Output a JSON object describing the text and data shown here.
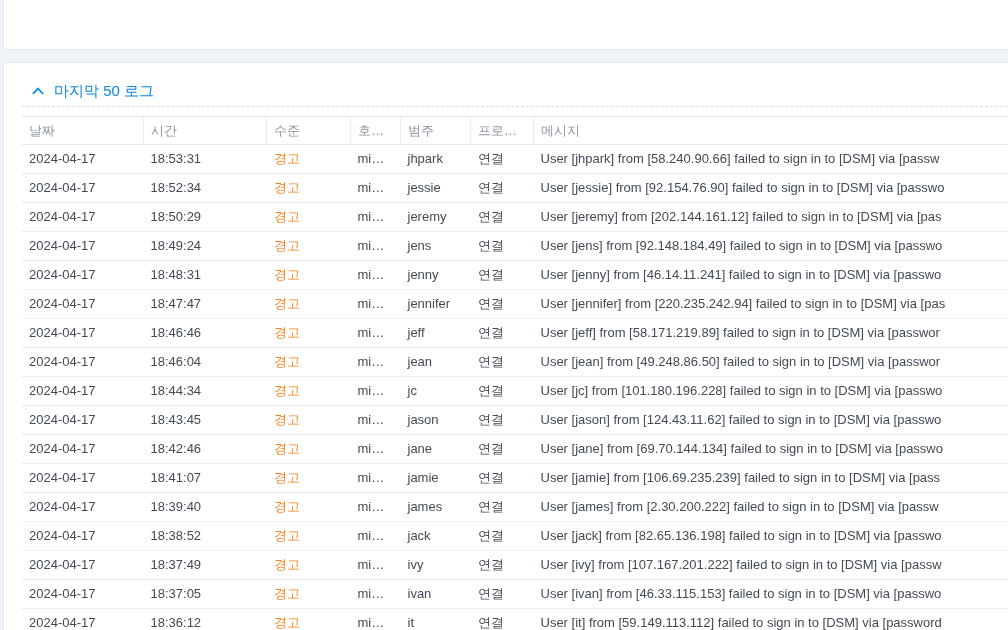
{
  "log_panel": {
    "title": "마지막 50 로그",
    "expanded": true,
    "table": {
      "columns": [
        "날짜",
        "시간",
        "수준",
        "호…",
        "범주",
        "프로…",
        "메시지"
      ],
      "rows": [
        {
          "date": "2024-04-17",
          "time": "18:53:31",
          "severity": "경고",
          "color": "#f7821e",
          "host": "mi…",
          "user": "jhpark",
          "category": "연결",
          "message": "User [jhpark] from [58.240.90.66] failed to sign in to [DSM] via [passw"
        },
        {
          "date": "2024-04-17",
          "time": "18:52:34",
          "severity": "경고",
          "color": "#f7821e",
          "host": "mi…",
          "user": "jessie",
          "category": "연결",
          "message": "User [jessie] from [92.154.76.90] failed to sign in to [DSM] via [passwo"
        },
        {
          "date": "2024-04-17",
          "time": "18:50:29",
          "severity": "경고",
          "color": "#f7821e",
          "host": "mi…",
          "user": "jeremy",
          "category": "연결",
          "message": "User [jeremy] from [202.144.161.12] failed to sign in to [DSM] via [pas"
        },
        {
          "date": "2024-04-17",
          "time": "18:49:24",
          "severity": "경고",
          "color": "#f7821e",
          "host": "mi…",
          "user": "jens",
          "category": "연결",
          "message": "User [jens] from [92.148.184.49] failed to sign in to [DSM] via [passwo"
        },
        {
          "date": "2024-04-17",
          "time": "18:48:31",
          "severity": "경고",
          "color": "#f7821e",
          "host": "mi…",
          "user": "jenny",
          "category": "연결",
          "message": "User [jenny] from [46.14.11.241] failed to sign in to [DSM] via [passwo"
        },
        {
          "date": "2024-04-17",
          "time": "18:47:47",
          "severity": "경고",
          "color": "#f7821e",
          "host": "mi…",
          "user": "jennifer",
          "category": "연결",
          "message": "User [jennifer] from [220.235.242.94] failed to sign in to [DSM] via [pas"
        },
        {
          "date": "2024-04-17",
          "time": "18:46:46",
          "severity": "경고",
          "color": "#f7821e",
          "host": "mi…",
          "user": "jeff",
          "category": "연결",
          "message": "User [jeff] from [58.171.219.89] failed to sign in to [DSM] via [passwor"
        },
        {
          "date": "2024-04-17",
          "time": "18:46:04",
          "severity": "경고",
          "color": "#f7821e",
          "host": "mi…",
          "user": "jean",
          "category": "연결",
          "message": "User [jean] from [49.248.86.50] failed to sign in to [DSM] via [passwor"
        },
        {
          "date": "2024-04-17",
          "time": "18:44:34",
          "severity": "경고",
          "color": "#f7821e",
          "host": "mi…",
          "user": "jc",
          "category": "연결",
          "message": "User [jc] from [101.180.196.228] failed to sign in to [DSM] via [passwo"
        },
        {
          "date": "2024-04-17",
          "time": "18:43:45",
          "severity": "경고",
          "color": "#f7821e",
          "host": "mi…",
          "user": "jason",
          "category": "연결",
          "message": "User [jason] from [124.43.11.62] failed to sign in to [DSM] via [passwo"
        },
        {
          "date": "2024-04-17",
          "time": "18:42:46",
          "severity": "경고",
          "color": "#f7821e",
          "host": "mi…",
          "user": "jane",
          "category": "연결",
          "message": "User [jane] from [69.70.144.134] failed to sign in to [DSM] via [passwo"
        },
        {
          "date": "2024-04-17",
          "time": "18:41:07",
          "severity": "경고",
          "color": "#f7821e",
          "host": "mi…",
          "user": "jamie",
          "category": "연결",
          "message": "User [jamie] from [106.69.235.239] failed to sign in to [DSM] via [pass"
        },
        {
          "date": "2024-04-17",
          "time": "18:39:40",
          "severity": "경고",
          "color": "#f7821e",
          "host": "mi…",
          "user": "james",
          "category": "연결",
          "message": "User [james] from [2.30.200.222] failed to sign in to [DSM] via [passw"
        },
        {
          "date": "2024-04-17",
          "time": "18:38:52",
          "severity": "경고",
          "color": "#f7821e",
          "host": "mi…",
          "user": "jack",
          "category": "연결",
          "message": "User [jack] from [82.65.136.198] failed to sign in to [DSM] via [passwo"
        },
        {
          "date": "2024-04-17",
          "time": "18:37:49",
          "severity": "경고",
          "color": "#f7821e",
          "host": "mi…",
          "user": "ivy",
          "category": "연결",
          "message": "User [ivy] from [107.167.201.222] failed to sign in to [DSM] via [passw"
        },
        {
          "date": "2024-04-17",
          "time": "18:37:05",
          "severity": "경고",
          "color": "#f7821e",
          "host": "mi…",
          "user": "ivan",
          "category": "연결",
          "message": "User [ivan] from [46.33.115.153] failed to sign in to [DSM] via [passwo"
        },
        {
          "date": "2024-04-17",
          "time": "18:36:12",
          "severity": "경고",
          "color": "#f7821e",
          "host": "mi…",
          "user": "it",
          "category": "연결",
          "message": "User [it] from [59.149.113.112] failed to sign in to [DSM] via [password"
        }
      ]
    }
  }
}
